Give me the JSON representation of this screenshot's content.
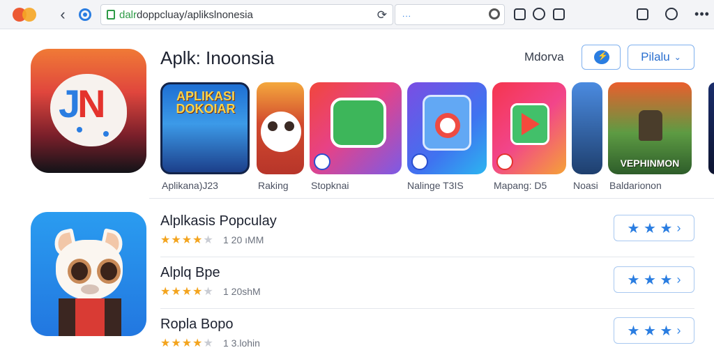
{
  "browser": {
    "url": "dalrdoppcluay/aplikslnonesia",
    "url_domain": "dalr",
    "url_path": "doppcluay/aplikslnonesia",
    "search_placeholder": "..."
  },
  "header": {
    "title": "Aplk: Inoonsia",
    "language_label": "Mdorva",
    "dropdown_label": "Pilalu",
    "dropdown_chevron": "⌄"
  },
  "featured": [
    {
      "label": "Aplikana)J23",
      "art_text": "APLIKASI DOKOIAR"
    },
    {
      "label": "Raking"
    },
    {
      "label": "Stopknai"
    },
    {
      "label": "Nalinge T3IS"
    },
    {
      "label": "Mapang: D5"
    },
    {
      "label": "Noasi"
    },
    {
      "label": "Baldarionon",
      "art_text": "VEPHINMON"
    }
  ],
  "popular": [
    {
      "name": "Alplkasis Popculay",
      "rating": 4,
      "meta": "1 20 ıMM"
    },
    {
      "name": "Alplq Bpe",
      "rating": 4,
      "meta": "1 20shM"
    },
    {
      "name": "Ropla Bopo",
      "rating": 4,
      "meta": "1 3.lohin"
    }
  ],
  "rate_button": {
    "stars": "★ ★ ★",
    "arrow": "›"
  },
  "icons": {
    "hero": "JN",
    "hero_j": "J",
    "hero_n": "N",
    "back": "‹",
    "reload": "⟳"
  },
  "colors": {
    "accent": "#2a7de1",
    "star": "#f3a41e",
    "hero_gradient_top": "#f07a36",
    "hero_gradient_bottom": "#121318",
    "popular_icon": "#2a9cf0"
  }
}
